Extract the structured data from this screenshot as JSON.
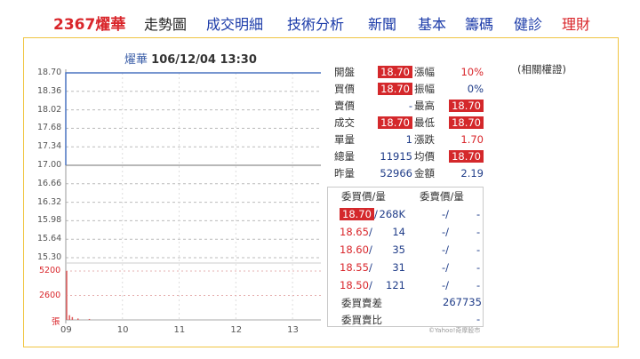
{
  "nav": {
    "stock": "2367燿華",
    "items": [
      {
        "label": "走勢圖",
        "color": "black"
      },
      {
        "label": "成交明細",
        "color": "blue"
      },
      {
        "label": "技術分析",
        "color": "blue"
      },
      {
        "label": "新聞",
        "color": "blue"
      },
      {
        "label": "基本",
        "color": "blue"
      },
      {
        "label": "籌碼",
        "color": "blue"
      },
      {
        "label": "健診",
        "color": "blue"
      },
      {
        "label": "理財",
        "color": "red"
      }
    ]
  },
  "chart": {
    "name": "燿華",
    "datetime": "106/12/04 13:30"
  },
  "chart_data": {
    "type": "line",
    "price_axis": {
      "ticks": [
        "18.70",
        "18.36",
        "18.02",
        "17.68",
        "17.34",
        "17.00",
        "16.66",
        "16.32",
        "15.98",
        "15.64",
        "15.30"
      ],
      "range": [
        15.3,
        18.7
      ],
      "reference": 17.0
    },
    "volume_axis": {
      "ticks": [
        "5200",
        "2600",
        "張"
      ],
      "range": [
        0,
        5200
      ]
    },
    "x_ticks": [
      "09",
      "10",
      "11",
      "12",
      "13"
    ],
    "price_series": [
      {
        "t": 9.0,
        "price": 17.0
      },
      {
        "t": 9.0,
        "price": 18.7
      },
      {
        "t": 13.5,
        "price": 18.7
      }
    ],
    "volume_series": [
      {
        "t": 9.0,
        "vol": 5200
      },
      {
        "t": 9.05,
        "vol": 500
      },
      {
        "t": 9.1,
        "vol": 300
      },
      {
        "t": 9.2,
        "vol": 150
      },
      {
        "t": 9.4,
        "vol": 100
      }
    ],
    "grid": true,
    "colors": {
      "price_line": "#4a74c0",
      "volume": "#e05a5a",
      "reference_line": "#a0a0a0"
    }
  },
  "quote": {
    "left": [
      {
        "label": "開盤",
        "value": "18.70",
        "hl": true
      },
      {
        "label": "買價",
        "value": "18.70",
        "hl": true
      },
      {
        "label": "賣價",
        "value": "-",
        "hl": false
      },
      {
        "label": "成交",
        "value": "18.70",
        "hl": true
      },
      {
        "label": "單量",
        "value": "1",
        "hl": false
      },
      {
        "label": "總量",
        "value": "11915",
        "hl": false
      },
      {
        "label": "昨量",
        "value": "52966",
        "hl": false
      }
    ],
    "right": [
      {
        "label": "漲幅",
        "value": "10%",
        "style": "red"
      },
      {
        "label": "振幅",
        "value": "0%",
        "style": "blue"
      },
      {
        "label": "最高",
        "value": "18.70",
        "style": "hl"
      },
      {
        "label": "最低",
        "value": "18.70",
        "style": "hl"
      },
      {
        "label": "漲跌",
        "value": "1.70",
        "style": "red"
      },
      {
        "label": "均價",
        "value": "18.70",
        "style": "hl"
      },
      {
        "label": "金額",
        "value": "2.19",
        "style": "blue"
      }
    ],
    "note": "(相關權證)"
  },
  "orderbook": {
    "bid_header": "委買價/量",
    "ask_header": "委賣價/量",
    "rows": [
      {
        "bid_price": "18.70",
        "bid_vol": "268K",
        "ask_price": "-",
        "ask_vol": "-",
        "hl": true
      },
      {
        "bid_price": "18.65",
        "bid_vol": "14",
        "ask_price": "-",
        "ask_vol": "-",
        "hl": false
      },
      {
        "bid_price": "18.60",
        "bid_vol": "35",
        "ask_price": "-",
        "ask_vol": "-",
        "hl": false
      },
      {
        "bid_price": "18.55",
        "bid_vol": "31",
        "ask_price": "-",
        "ask_vol": "-",
        "hl": false
      },
      {
        "bid_price": "18.50",
        "bid_vol": "121",
        "ask_price": "-",
        "ask_vol": "-",
        "hl": false
      }
    ],
    "diff_label": "委買賣差",
    "diff_value": "267735",
    "ratio_label": "委買賣比",
    "ratio_value": "-"
  },
  "credit": "©Yahoo!奇摩股市"
}
